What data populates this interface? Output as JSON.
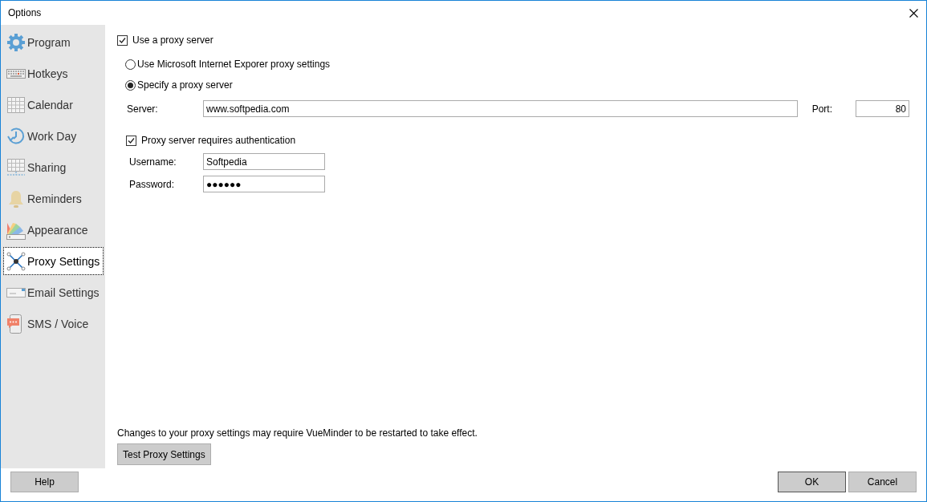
{
  "window": {
    "title": "Options"
  },
  "sidebar": {
    "items": [
      {
        "label": "Program",
        "selected": false
      },
      {
        "label": "Hotkeys",
        "selected": false
      },
      {
        "label": "Calendar",
        "selected": false
      },
      {
        "label": "Work Day",
        "selected": false
      },
      {
        "label": "Sharing",
        "selected": false
      },
      {
        "label": "Reminders",
        "selected": false
      },
      {
        "label": "Appearance",
        "selected": false
      },
      {
        "label": "Proxy Settings",
        "selected": true
      },
      {
        "label": "Email Settings",
        "selected": false
      },
      {
        "label": "SMS / Voice",
        "selected": false
      }
    ]
  },
  "proxy": {
    "use_proxy": {
      "label": "Use a proxy server",
      "checked": true
    },
    "options": [
      {
        "label": "Use Microsoft Internet Exporer proxy settings",
        "selected": false
      },
      {
        "label": "Specify a proxy server",
        "selected": true
      }
    ],
    "server": {
      "label": "Server:",
      "value": "www.softpedia.com"
    },
    "port": {
      "label": "Port:",
      "value": "80"
    },
    "auth": {
      "label": "Proxy server requires authentication",
      "checked": true
    },
    "username": {
      "label": "Username:",
      "value": "Softpedia"
    },
    "password": {
      "label": "Password:",
      "value": "●●●●●●"
    },
    "note": "Changes to your proxy settings may require VueMinder to be restarted to take effect.",
    "test_button": "Test Proxy Settings"
  },
  "footer": {
    "help": "Help",
    "ok": "OK",
    "cancel": "Cancel"
  }
}
